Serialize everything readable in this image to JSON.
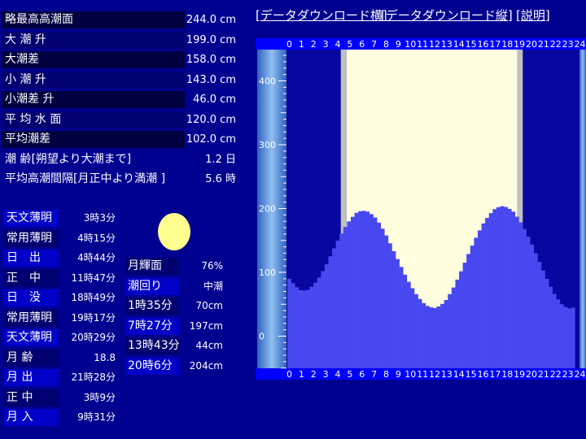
{
  "tide_stats": [
    {
      "label": "略最高高潮面",
      "value": "244.0 cm"
    },
    {
      "label": "大 潮 升",
      "value": "199.0 cm"
    },
    {
      "label": "大潮差",
      "value": "158.0 cm"
    },
    {
      "label": "小 潮 升",
      "value": "143.0 cm"
    },
    {
      "label": "小潮差 升",
      "value": "46.0 cm"
    },
    {
      "label": "平 均 水 面",
      "value": "120.0 cm"
    },
    {
      "label": "平均潮差",
      "value": "102.0 cm"
    },
    {
      "label": "潮 齢[朔望より大潮まで]",
      "value": "1.2 日"
    },
    {
      "label": "平均高潮間隔[月正中より満潮 ]",
      "value": "5.6 時"
    }
  ],
  "sun_moon_times": [
    {
      "label": "天文薄明",
      "value": "3時3分"
    },
    {
      "label": "常用薄明",
      "value": "4時15分"
    },
    {
      "label": "日　出",
      "value": "4時44分"
    },
    {
      "label": "正　中",
      "value": "11時47分"
    },
    {
      "label": "日　没",
      "value": "18時49分"
    },
    {
      "label": "常用薄明",
      "value": "19時17分"
    },
    {
      "label": "天文薄明",
      "value": "20時29分"
    },
    {
      "label": "月 齢",
      "value": "18.8"
    },
    {
      "label": "月 出",
      "value": "21時28分"
    },
    {
      "label": "正 中",
      "value": "3時9分"
    },
    {
      "label": "月 入",
      "value": "9時31分"
    }
  ],
  "moon_info": [
    {
      "label": "月輝面",
      "value": "76%"
    },
    {
      "label": "潮回り",
      "value": "中潮"
    },
    {
      "label": "1時35分",
      "value": "70cm"
    },
    {
      "label": "7時27分",
      "value": "197cm"
    },
    {
      "label": "13時43分",
      "value": "44cm"
    },
    {
      "label": "20時6分",
      "value": "204cm"
    }
  ],
  "links": {
    "download_horizontal": "[データダウンロード横]",
    "download_vertical": "[データダウンロード縦]",
    "explanation": "[説明]"
  },
  "colors": {
    "background": "#000090",
    "tide_fill": "#4848f0",
    "daylight": "#ffffe0",
    "twilight": "#c0c0c0",
    "night": "#0808a0",
    "moon": "#ffff90"
  },
  "chart_data": {
    "type": "area",
    "x_ticks": [
      "0",
      "1",
      "2",
      "3",
      "4",
      "5",
      "6",
      "7",
      "8",
      "9",
      "10",
      "11",
      "12",
      "13",
      "14",
      "15",
      "16",
      "17",
      "18",
      "19",
      "20",
      "21",
      "22",
      "23",
      "24"
    ],
    "y_ticks": [
      "0",
      "100",
      "200",
      "300",
      "400"
    ],
    "xlim": [
      0,
      24
    ],
    "ylim": [
      -50,
      450
    ],
    "daylight_hours": [
      4.73,
      18.82
    ],
    "twilight_hours": [
      [
        4.25,
        4.73
      ],
      [
        18.82,
        19.28
      ]
    ],
    "x": [
      0,
      0.5,
      1,
      1.5,
      2,
      2.5,
      3,
      3.5,
      4,
      4.5,
      5,
      5.5,
      6,
      6.5,
      7,
      7.5,
      8,
      8.5,
      9,
      9.5,
      10,
      10.5,
      11,
      11.5,
      12,
      12.5,
      13,
      13.5,
      14,
      14.5,
      15,
      15.5,
      16,
      16.5,
      17,
      17.5,
      18,
      18.5,
      19,
      19.5,
      20,
      20.5,
      21,
      21.5,
      22,
      22.5,
      23,
      23.5,
      24
    ],
    "values": [
      90,
      78,
      71,
      72,
      80,
      93,
      110,
      130,
      150,
      168,
      182,
      193,
      197,
      195,
      188,
      175,
      158,
      138,
      118,
      98,
      80,
      65,
      53,
      46,
      44,
      48,
      58,
      74,
      94,
      116,
      138,
      158,
      176,
      190,
      200,
      204,
      202,
      195,
      182,
      165,
      145,
      123,
      101,
      80,
      62,
      50,
      43,
      45
    ],
    "series": [
      {
        "values": []
      }
    ]
  }
}
